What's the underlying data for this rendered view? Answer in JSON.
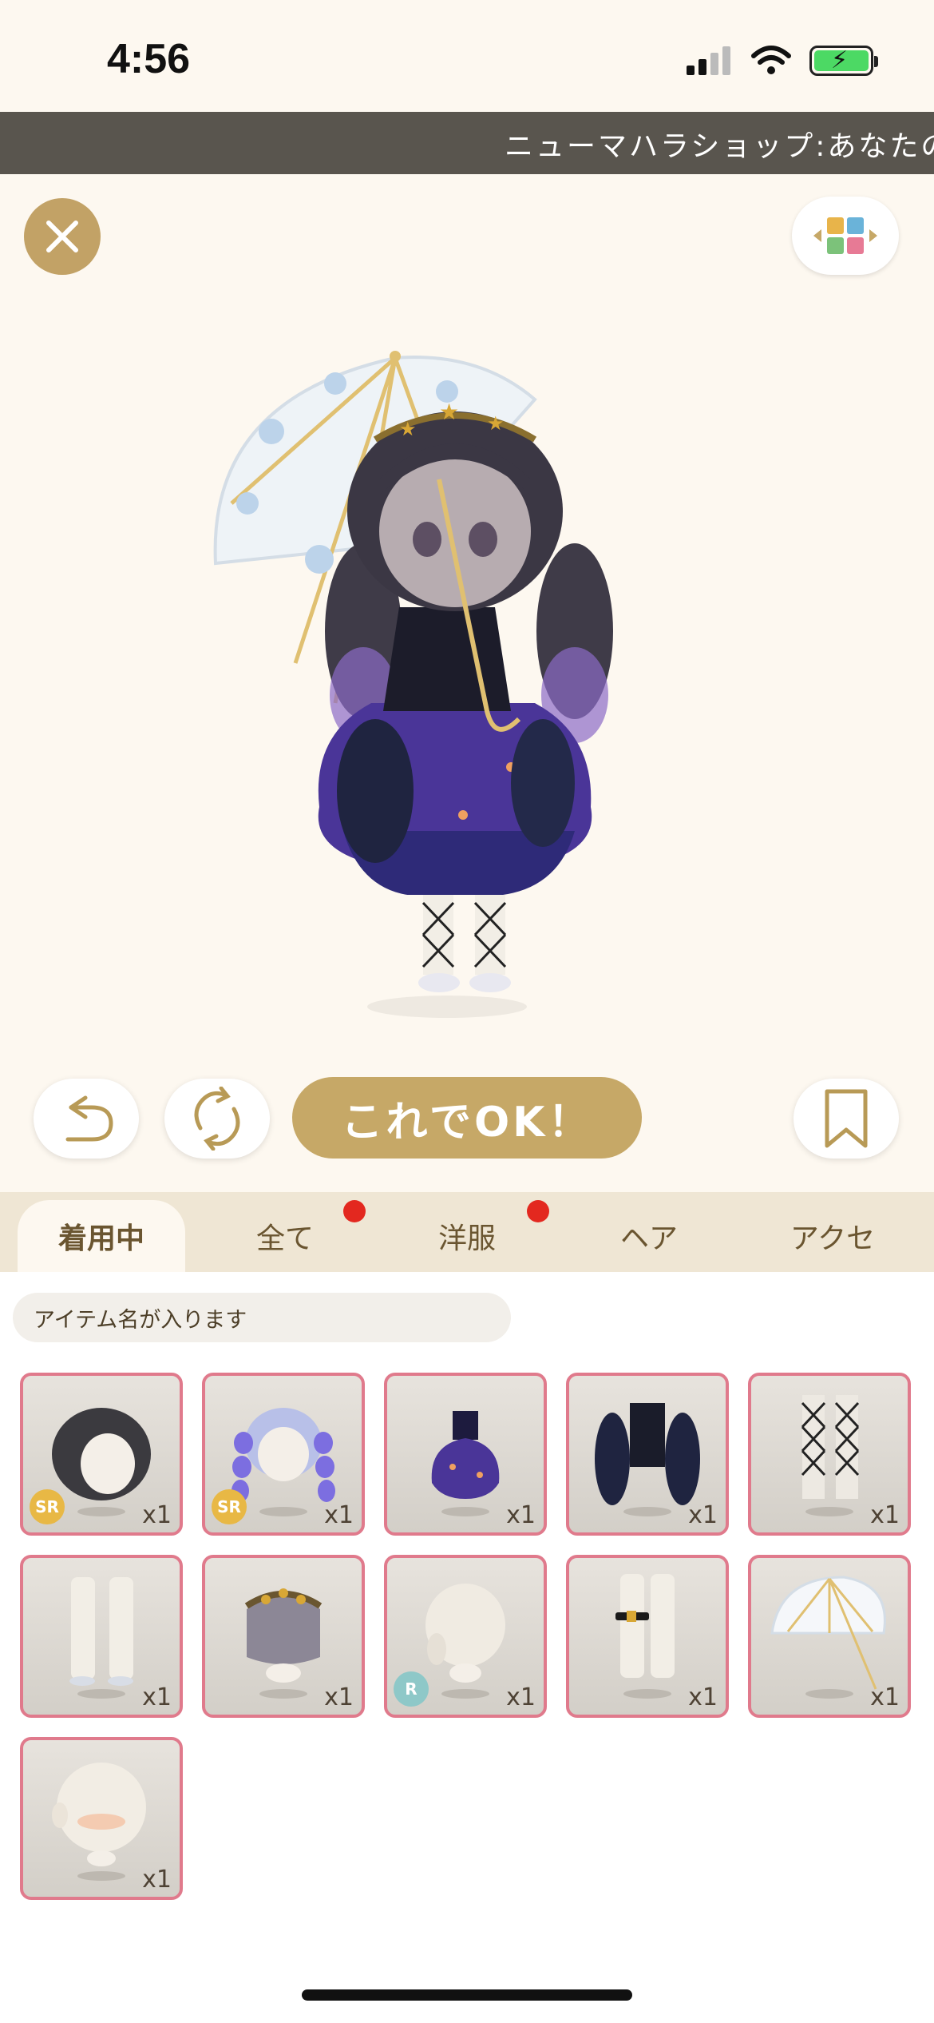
{
  "status_bar": {
    "time": "4:56"
  },
  "marquee": {
    "text": "ニューマハラショップ:あなたの"
  },
  "actions": {
    "ok_label": "これでOK！"
  },
  "tabs": [
    {
      "label": "着用中",
      "active": true,
      "badge": false
    },
    {
      "label": "全て",
      "active": false,
      "badge": true
    },
    {
      "label": "洋服",
      "active": false,
      "badge": true
    },
    {
      "label": "ヘア",
      "active": false,
      "badge": false
    },
    {
      "label": "アクセ",
      "active": false,
      "badge": false
    }
  ],
  "search": {
    "placeholder": "アイテム名が入ります"
  },
  "items": [
    {
      "name": "hair-bob",
      "qty": "x1",
      "rarity": "SR"
    },
    {
      "name": "hair-twin-braids",
      "qty": "x1",
      "rarity": "SR"
    },
    {
      "name": "dress-galaxy",
      "qty": "x1",
      "rarity": ""
    },
    {
      "name": "top-black-puff",
      "qty": "x1",
      "rarity": ""
    },
    {
      "name": "fishnet-stockings",
      "qty": "x1",
      "rarity": ""
    },
    {
      "name": "white-socks",
      "qty": "x1",
      "rarity": ""
    },
    {
      "name": "star-headdress",
      "qty": "x1",
      "rarity": ""
    },
    {
      "name": "hair-base",
      "qty": "x1",
      "rarity": "R"
    },
    {
      "name": "leg-garter",
      "qty": "x1",
      "rarity": ""
    },
    {
      "name": "lace-umbrella",
      "qty": "x1",
      "rarity": ""
    },
    {
      "name": "face-blush",
      "qty": "x1",
      "rarity": ""
    }
  ],
  "colors": {
    "accent": "#c6a867",
    "item_border": "#e07a8c",
    "badge": "#e3281f",
    "marquee_bg": "#59554e"
  }
}
